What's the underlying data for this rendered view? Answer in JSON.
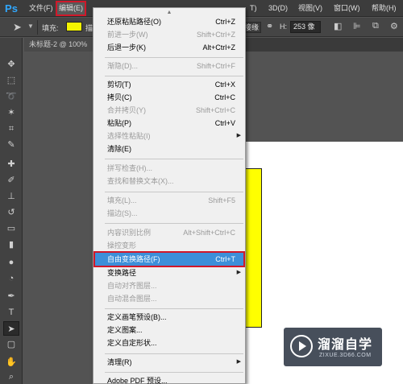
{
  "app": {
    "logo": "Ps"
  },
  "menubar": {
    "items": [
      {
        "label": "文件(F)"
      },
      {
        "label": "编辑(E)"
      },
      {
        "label": "T)"
      },
      {
        "label": "3D(D)"
      },
      {
        "label": "视图(V)"
      },
      {
        "label": "窗口(W)"
      },
      {
        "label": "帮助(H)"
      }
    ]
  },
  "options": {
    "fill_label": "填充:",
    "fill_color": "#f5f500",
    "stroke_fragment": "描",
    "align_fragment": "接缘",
    "h_label": "H:",
    "h_value": "253 像"
  },
  "document": {
    "tab_label": "未标题-2 @ 100%"
  },
  "edit_menu": {
    "items": [
      {
        "label": "还原粘贴路径(O)",
        "shortcut": "Ctrl+Z",
        "enabled": true
      },
      {
        "label": "前进一步(W)",
        "shortcut": "Shift+Ctrl+Z",
        "enabled": false
      },
      {
        "label": "后退一步(K)",
        "shortcut": "Alt+Ctrl+Z",
        "enabled": true
      },
      {
        "label": "渐隐(D)...",
        "shortcut": "Shift+Ctrl+F",
        "enabled": false
      },
      {
        "label": "剪切(T)",
        "shortcut": "Ctrl+X",
        "enabled": true
      },
      {
        "label": "拷贝(C)",
        "shortcut": "Ctrl+C",
        "enabled": true
      },
      {
        "label": "合并拷贝(Y)",
        "shortcut": "Shift+Ctrl+C",
        "enabled": false
      },
      {
        "label": "粘贴(P)",
        "shortcut": "Ctrl+V",
        "enabled": true
      },
      {
        "label": "选择性粘贴(I)",
        "shortcut": "",
        "enabled": false,
        "submenu": true
      },
      {
        "label": "清除(E)",
        "shortcut": "",
        "enabled": true
      },
      {
        "label": "拼写检查(H)...",
        "shortcut": "",
        "enabled": false
      },
      {
        "label": "查找和替换文本(X)...",
        "shortcut": "",
        "enabled": false
      },
      {
        "label": "填充(L)...",
        "shortcut": "Shift+F5",
        "enabled": false
      },
      {
        "label": "描边(S)...",
        "shortcut": "",
        "enabled": false
      },
      {
        "label": "内容识别比例",
        "shortcut": "Alt+Shift+Ctrl+C",
        "enabled": false
      },
      {
        "label": "操控变形",
        "shortcut": "",
        "enabled": false
      },
      {
        "label": "自由变换路径(F)",
        "shortcut": "Ctrl+T",
        "enabled": true,
        "highlighted": true
      },
      {
        "label": "变换路径",
        "shortcut": "",
        "enabled": true,
        "submenu": true
      },
      {
        "label": "自动对齐图层...",
        "shortcut": "",
        "enabled": false
      },
      {
        "label": "自动混合图层...",
        "shortcut": "",
        "enabled": false
      },
      {
        "label": "定义画笔预设(B)...",
        "shortcut": "",
        "enabled": true
      },
      {
        "label": "定义图案...",
        "shortcut": "",
        "enabled": true
      },
      {
        "label": "定义自定形状...",
        "shortcut": "",
        "enabled": true
      },
      {
        "label": "清理(R)",
        "shortcut": "",
        "enabled": true,
        "submenu": true
      },
      {
        "label": "Adobe PDF 预设...",
        "shortcut": "",
        "enabled": true
      }
    ]
  },
  "watermark": {
    "title": "溜溜自学",
    "subtitle": "ZIXUE.3D66.COM"
  },
  "colors": {
    "highlight": "#3d8fd9",
    "annotation_red": "#d0182a",
    "shape_yellow": "#ffff00"
  }
}
